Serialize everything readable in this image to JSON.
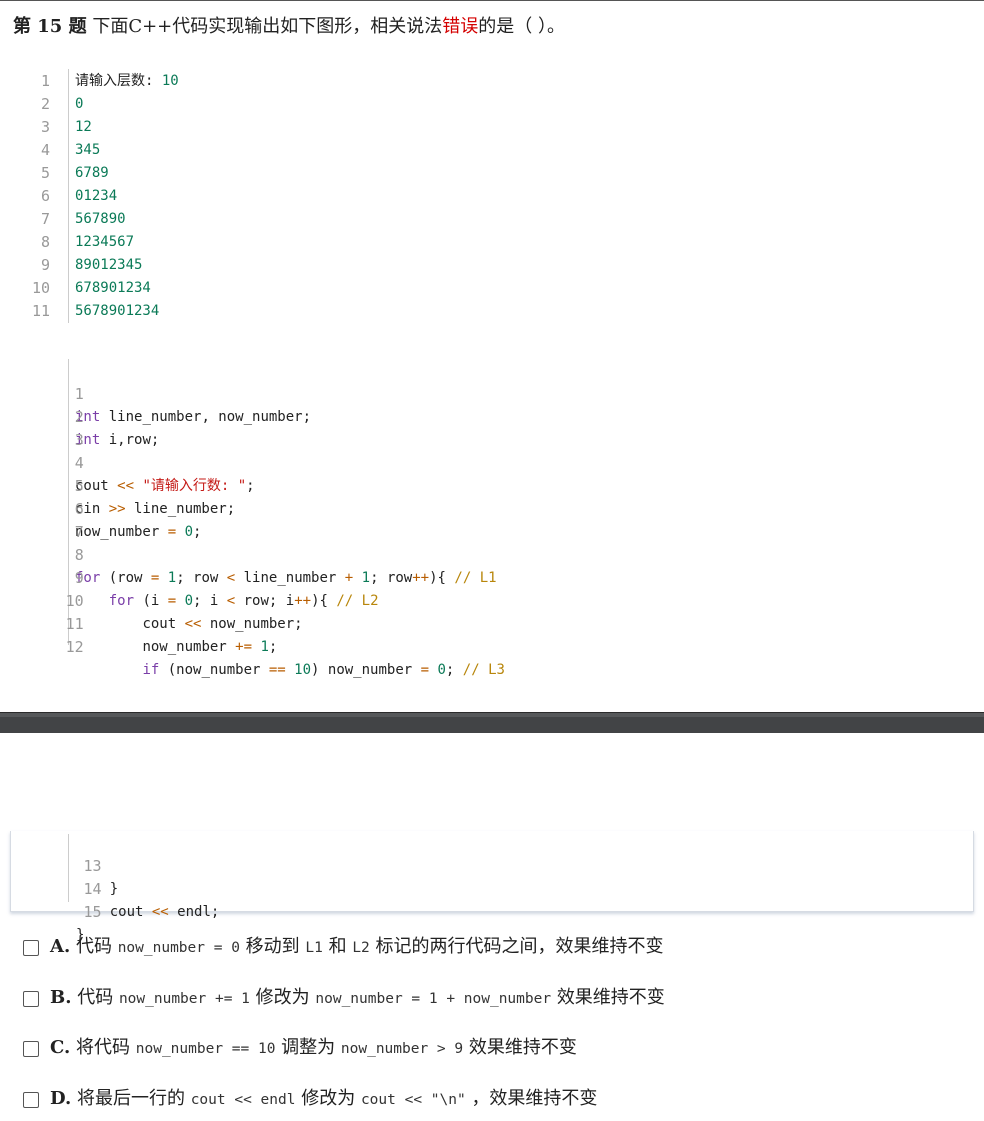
{
  "question": {
    "number": "第 15 题",
    "text_before": "下面C++代码实现输出如下图形，相关说法",
    "text_red": "错误",
    "text_after": "的是（    ）。"
  },
  "output_block": {
    "lines": [
      {
        "n": "1",
        "text": "请输入层数: 10"
      },
      {
        "n": "2",
        "text": "0"
      },
      {
        "n": "3",
        "text": "12"
      },
      {
        "n": "4",
        "text": "345"
      },
      {
        "n": "5",
        "text": "6789"
      },
      {
        "n": "6",
        "text": "01234"
      },
      {
        "n": "7",
        "text": "567890"
      },
      {
        "n": "8",
        "text": "1234567"
      },
      {
        "n": "9",
        "text": "89012345"
      },
      {
        "n": "10",
        "text": "678901234"
      },
      {
        "n": "11",
        "text": "5678901234"
      }
    ]
  },
  "code_block": {
    "line_numbers": [
      "1",
      "2",
      "3",
      "4",
      "5",
      "6",
      "7",
      "8",
      "9",
      "10",
      "11",
      "12"
    ],
    "l1_kw": "int",
    "l1_rest": " line_number, now_number;",
    "l2_kw": "int",
    "l2_rest": " i,row;",
    "l4_a": "cout ",
    "l4_op": "<<",
    "l4_sp": " ",
    "l4_str": "\"请输入行数: \"",
    "l4_end": ";",
    "l5_a": "cin ",
    "l5_op": ">>",
    "l5_rest": " line_number;",
    "l6_a": "now_number ",
    "l6_op": "=",
    "l6_sp": " ",
    "l6_num": "0",
    "l6_end": ";",
    "l8_kw": "for",
    "l8_a": " (row ",
    "l8_op1": "=",
    "l8_sp1": " ",
    "l8_n1": "1",
    "l8_b": "; row ",
    "l8_op2": "<",
    "l8_c": " line_number ",
    "l8_op3": "+",
    "l8_sp2": " ",
    "l8_n2": "1",
    "l8_d": "; row",
    "l8_op4": "++",
    "l8_e": "){ ",
    "l8_cmt": "// L1",
    "l9_indent": "    ",
    "l9_kw": "for",
    "l9_a": " (i ",
    "l9_op1": "=",
    "l9_sp1": " ",
    "l9_n1": "0",
    "l9_b": "; i ",
    "l9_op2": "<",
    "l9_c": " row; i",
    "l9_op3": "++",
    "l9_d": "){ ",
    "l9_cmt": "// L2",
    "l10_indent": "        ",
    "l10_a": "cout ",
    "l10_op": "<<",
    "l10_rest": " now_number;",
    "l11_indent": "        ",
    "l11_a": "now_number ",
    "l11_op": "+=",
    "l11_sp": " ",
    "l11_num": "1",
    "l11_end": ";",
    "l12_indent": "        ",
    "l12_kw": "if",
    "l12_a": " (now_number ",
    "l12_op1": "==",
    "l12_sp1": " ",
    "l12_n1": "10",
    "l12_b": ") now_number ",
    "l12_op2": "=",
    "l12_sp2": " ",
    "l12_n2": "0",
    "l12_c": "; ",
    "l12_cmt": "// L3"
  },
  "code_block_cont": {
    "line_numbers": [
      "13",
      "14",
      "15"
    ],
    "l13": "    }",
    "l14_indent": "    ",
    "l14_a": "cout ",
    "l14_op": "<<",
    "l14_rest": " endl;",
    "l15": "}"
  },
  "options": [
    {
      "letter": "A.",
      "p1": "代码",
      "c1": "now_number = 0",
      "p2": "移动到",
      "c2": "L1",
      "p3": "和",
      "c3": "L2",
      "p4": "标记的两行代码之间，效果维持不变"
    },
    {
      "letter": "B.",
      "p1": "代码",
      "c1": "now_number += 1",
      "p2": "修改为",
      "c2": "now_number = 1 + now_number",
      "p3": "效果维持不变"
    },
    {
      "letter": "C.",
      "p1": "将代码",
      "c1": "now_number == 10",
      "p2": "调整为",
      "c2": "now_number > 9",
      "p3": "效果维持不变"
    },
    {
      "letter": "D.",
      "p1": "将最后一行的",
      "c1": "cout << endl",
      "p2": "修改为",
      "c2": "cout << \"\\n\"",
      "p3": "，效果维持不变"
    }
  ],
  "colors": {
    "number": "#0b7a57",
    "keyword": "#7a3ea8",
    "string": "#c41a16",
    "comment": "#b8860b",
    "operator": "#b85d00",
    "highlight_red": "#d40000"
  }
}
